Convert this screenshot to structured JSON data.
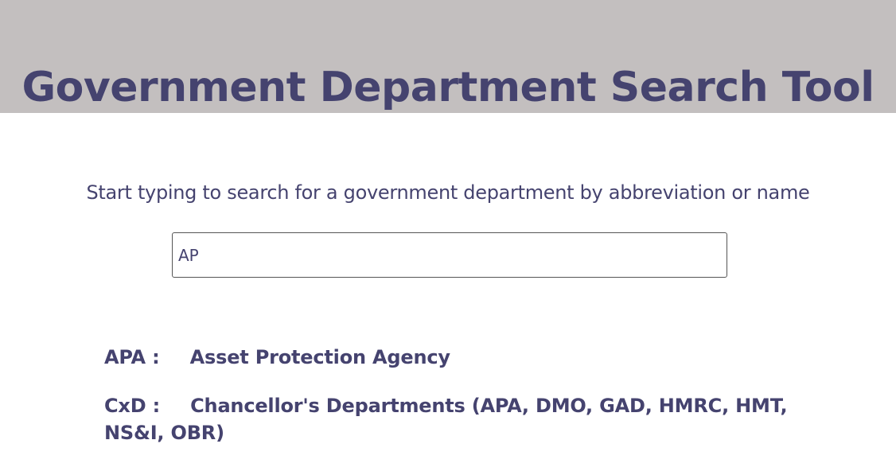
{
  "header": {
    "title": "Government Department Search Tool"
  },
  "search": {
    "instructions": "Start typing to search for a government department by abbreviation or name",
    "value": "AP",
    "placeholder": ""
  },
  "results": [
    {
      "abbreviation": "APA",
      "separator": " :",
      "name": "Asset Protection Agency"
    },
    {
      "abbreviation": "CxD",
      "separator": " :",
      "name": "Chancellor's Departments (APA, DMO, GAD, HMRC, HMT, NS&I, OBR)"
    }
  ],
  "colors": {
    "header_background": "#c3bfbf",
    "text": "#45436f",
    "background": "#ffffff"
  }
}
